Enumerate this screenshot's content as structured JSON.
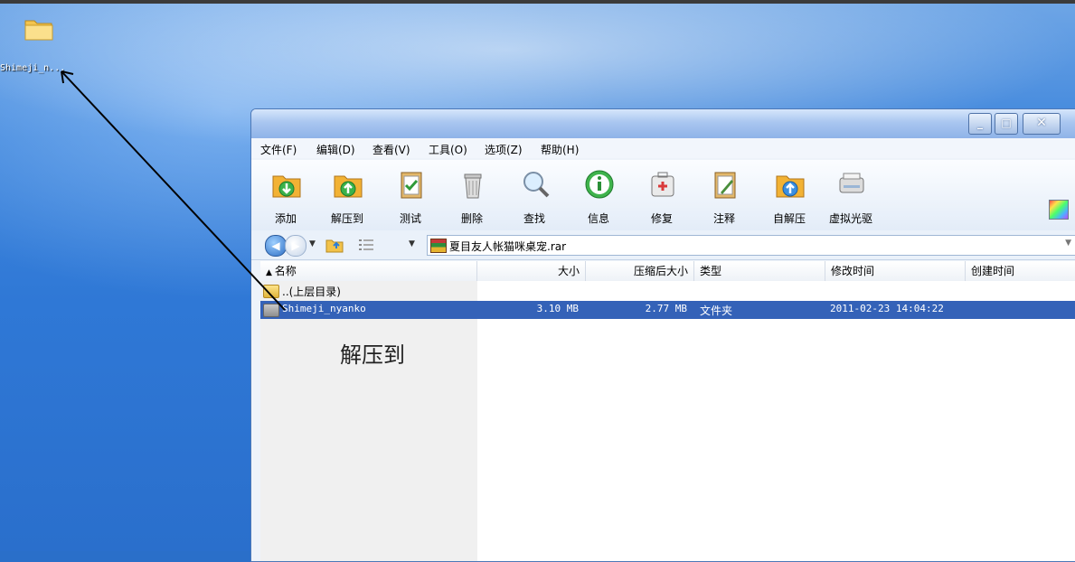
{
  "desktop": {
    "icon_label": "Shimeji_n..."
  },
  "window": {
    "controls": {
      "minimize": "_",
      "maximize": "□",
      "close": "✕"
    },
    "menu": [
      "文件(F)",
      "编辑(D)",
      "查看(V)",
      "工具(O)",
      "选项(Z)",
      "帮助(H)"
    ],
    "toolbar": [
      {
        "label": "添加",
        "icon": "add-folder-icon"
      },
      {
        "label": "解压到",
        "icon": "extract-to-icon"
      },
      {
        "label": "测试",
        "icon": "test-clipboard-icon"
      },
      {
        "label": "删除",
        "icon": "trash-icon"
      },
      {
        "label": "查找",
        "icon": "magnifier-icon"
      },
      {
        "label": "信息",
        "icon": "info-icon"
      },
      {
        "label": "修复",
        "icon": "repair-kit-icon"
      },
      {
        "label": "注释",
        "icon": "comment-notepad-icon"
      },
      {
        "label": "自解压",
        "icon": "self-extract-icon"
      },
      {
        "label": "虚拟光驱",
        "icon": "virtual-drive-icon"
      }
    ],
    "path": "夏目友人帐猫咪桌宠.rar",
    "columns": {
      "name": "名称",
      "size": "大小",
      "packed": "压缩后大小",
      "type": "类型",
      "modified": "修改时间",
      "created": "创建时间"
    },
    "rows": [
      {
        "name": "..(上层目录)",
        "size": "",
        "packed": "",
        "type": "",
        "modified": ""
      },
      {
        "name": "Shimeji_nyanko",
        "size": "3.10 MB",
        "packed": "2.77 MB",
        "type": "文件夹",
        "modified": "2011-02-23 14:04:22"
      }
    ]
  },
  "overlay_text": "解压到",
  "colors": {
    "selection": "#3462b8",
    "titlebar": "#a9c6f0",
    "desktop": "#2f78d6"
  }
}
